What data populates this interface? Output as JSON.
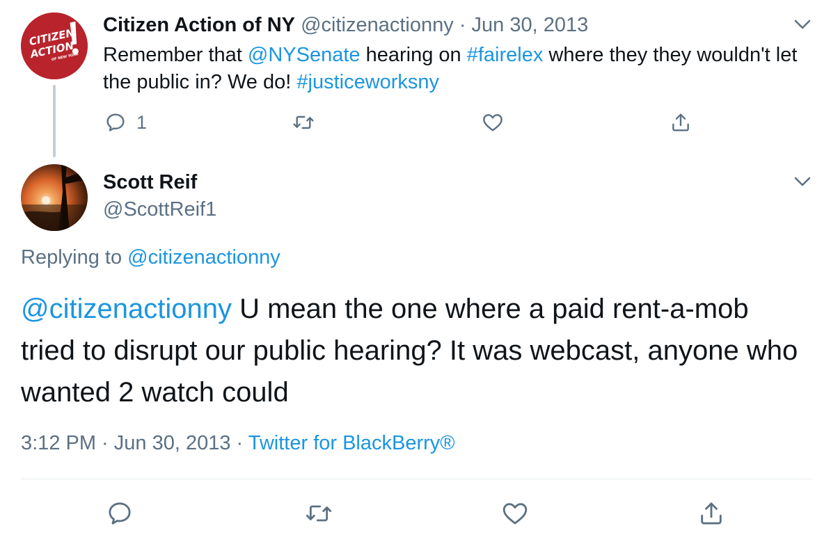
{
  "parent": {
    "avatar_text": [
      "CITIZEN",
      "ACTION",
      "OF NEW YORK"
    ],
    "name": "Citizen Action of NY",
    "handle": "@citizenactionny",
    "separator": "·",
    "date": "Jun 30, 2013",
    "text_parts": {
      "t1": "Remember that ",
      "m1": "@NYSenate",
      "t2": " hearing on ",
      "h1": "#fairelex",
      "t3": " where they they wouldn't let the public in? We do! ",
      "h2": "#justiceworksny"
    },
    "actions": {
      "reply_count": "1"
    }
  },
  "reply": {
    "name": "Scott Reif",
    "handle": "@ScottReif1",
    "replying_prefix": "Replying to ",
    "replying_handle": "@citizenactionny",
    "mention": "@citizenactionny",
    "body": " U mean the one where a paid rent-a-mob tried to disrupt our public hearing? It was webcast, anyone who wanted 2 watch could",
    "time": "3:12 PM",
    "sep1": " · ",
    "date": "Jun 30, 2013",
    "sep2": " · ",
    "source": "Twitter for BlackBerry®"
  },
  "icons": {
    "reply": "reply-icon",
    "retweet": "retweet-icon",
    "like": "heart-icon",
    "share": "share-icon",
    "more": "chevron-down-icon"
  },
  "colors": {
    "link": "#1b95e0",
    "secondary": "#5b7083",
    "brand_red": "#b8232c"
  }
}
